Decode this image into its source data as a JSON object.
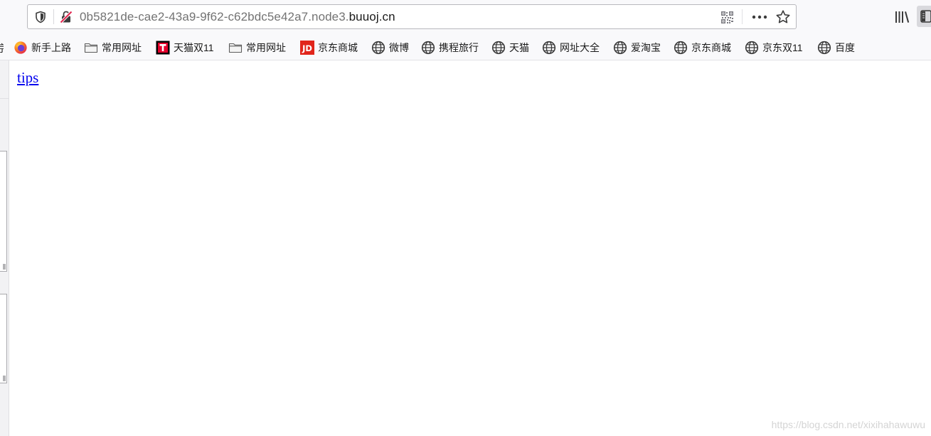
{
  "address_bar": {
    "url_prefix": "0b5821de-cae2-43a9-9f62-c62bdc5e42a7.node3.",
    "url_domain": "buuoj.cn"
  },
  "icons": {
    "tracking_protection": "shield-icon",
    "insecure_connection": "insecure-lock-icon",
    "qr_code": "qr-code-icon",
    "page_actions": "more-dots-icon",
    "bookmark_star": "star-icon",
    "library": "library-icon",
    "sidebar": "sidebar-icon"
  },
  "bookmarks": {
    "cut_label": "京",
    "items": [
      {
        "label": "新手上路",
        "icon": "firefox-icon"
      },
      {
        "label": "常用网址",
        "icon": "folder-icon"
      },
      {
        "label": "天猫双11",
        "icon": "tmall-icon"
      },
      {
        "label": "常用网址",
        "icon": "folder-icon"
      },
      {
        "label": "京东商城",
        "icon": "jd-icon"
      },
      {
        "label": "微博",
        "icon": "globe-icon"
      },
      {
        "label": "携程旅行",
        "icon": "globe-icon"
      },
      {
        "label": "天猫",
        "icon": "globe-icon"
      },
      {
        "label": "网址大全",
        "icon": "globe-icon"
      },
      {
        "label": "爱淘宝",
        "icon": "globe-icon"
      },
      {
        "label": "京东商城",
        "icon": "globe-icon"
      },
      {
        "label": "京东双11",
        "icon": "globe-icon"
      },
      {
        "label": "百度",
        "icon": "globe-icon"
      }
    ]
  },
  "page": {
    "link_text": "tips",
    "watermark": "https://blog.csdn.net/xixihahawuwu"
  },
  "colors": {
    "link": "#0000ee",
    "toolbar_bg": "#f9f9fb",
    "jd_red": "#e1251b",
    "tmall_red": "#e4002b"
  }
}
